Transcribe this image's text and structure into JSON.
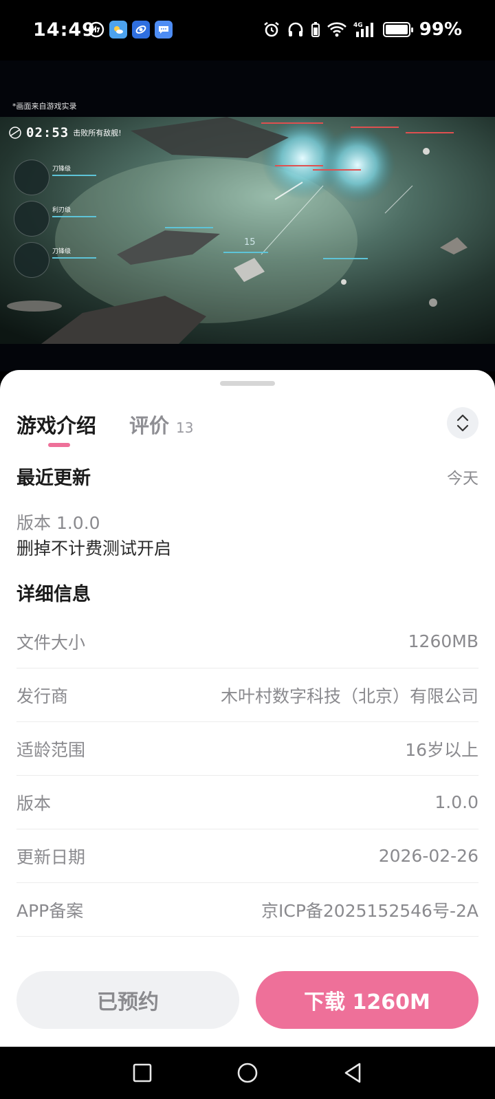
{
  "status_bar": {
    "time": "14:49",
    "battery": "99%",
    "network": "4G",
    "left_icons": [
      "data-saver-icon",
      "weather-app-icon",
      "app-icon",
      "message-app-icon"
    ],
    "right_icons": [
      "alarm-icon",
      "headphones-icon",
      "battery-small-icon",
      "wifi-icon",
      "signal-icon",
      "battery-icon"
    ]
  },
  "video": {
    "caption": "*画面来自游戏实录",
    "hud_timer": "02:53",
    "hud_mission": "击败所有敌舰!",
    "ships": [
      "刀锋级",
      "利刃级",
      "刀锋级"
    ],
    "combat_number": "15"
  },
  "tabs": {
    "intro": "游戏介绍",
    "review": "评价",
    "review_count": "13"
  },
  "recent_update": {
    "title": "最近更新",
    "date": "今天",
    "version": "版本 1.0.0",
    "notes": "删掉不计费测试开启"
  },
  "details": {
    "title": "详细信息",
    "rows": [
      {
        "label": "文件大小",
        "value": "1260MB"
      },
      {
        "label": "发行商",
        "value": "木叶村数字科技（北京）有限公司"
      },
      {
        "label": "适龄范围",
        "value": "16岁以上"
      },
      {
        "label": "版本",
        "value": "1.0.0"
      },
      {
        "label": "更新日期",
        "value": "2026-02-26"
      },
      {
        "label": "APP备案",
        "value": "京ICP备2025152546号-2A"
      }
    ]
  },
  "actions": {
    "reserved": "已预约",
    "download": "下载 1260M"
  },
  "colors": {
    "accent": "#ee7099",
    "text_primary": "#1b1b1b",
    "text_secondary": "#8a8a8e"
  }
}
